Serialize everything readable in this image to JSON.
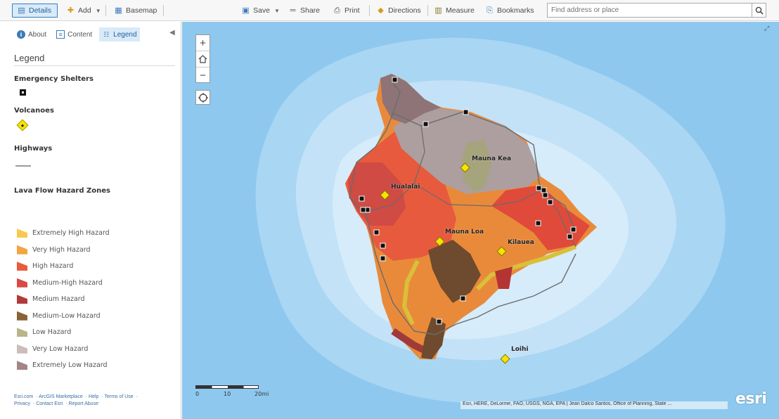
{
  "toolbar": {
    "details": "Details",
    "add": "Add",
    "basemap": "Basemap",
    "save": "Save",
    "share": "Share",
    "print": "Print",
    "directions": "Directions",
    "measure": "Measure",
    "bookmarks": "Bookmarks",
    "search_placeholder": "Find address or place"
  },
  "panel": {
    "tabs": [
      "About",
      "Content",
      "Legend"
    ],
    "active_tab": "Legend",
    "title": "Legend",
    "groups": {
      "shelters": "Emergency Shelters",
      "volcanoes": "Volcanoes",
      "highways": "Highways",
      "lava": "Lava Flow Hazard Zones"
    },
    "zones": [
      {
        "label": "Extremely High Hazard",
        "color": "#f9c94d"
      },
      {
        "label": "Very High Hazard",
        "color": "#f4a442"
      },
      {
        "label": "High Hazard",
        "color": "#ea5a3c"
      },
      {
        "label": "Medium-High Hazard",
        "color": "#d94a44"
      },
      {
        "label": "Medium Hazard",
        "color": "#b13a3a"
      },
      {
        "label": "Medium-Low Hazard",
        "color": "#8a6238"
      },
      {
        "label": "Low Hazard",
        "color": "#b9b48a"
      },
      {
        "label": "Very Low Hazard",
        "color": "#cdbcbc"
      },
      {
        "label": "Extremely Low Hazard",
        "color": "#a38585"
      }
    ],
    "footer": {
      "links": [
        "Esri.com",
        "ArcGIS Marketplace",
        "Help",
        "Terms of Use",
        "Privacy",
        "Contact Esri",
        "Report Abuse"
      ]
    }
  },
  "map": {
    "volcanoes": [
      "Mauna Kea",
      "Hualalai",
      "Mauna Loa",
      "Kilauea",
      "Loihi"
    ],
    "scale_labels": [
      "0",
      "10",
      "20mi"
    ],
    "attribution": "Esri, HERE, DeLorme, FAO, USGS, NGA, EPA | Jean Dalco Santos, Office of Planning, State ...",
    "logo": "esri"
  }
}
